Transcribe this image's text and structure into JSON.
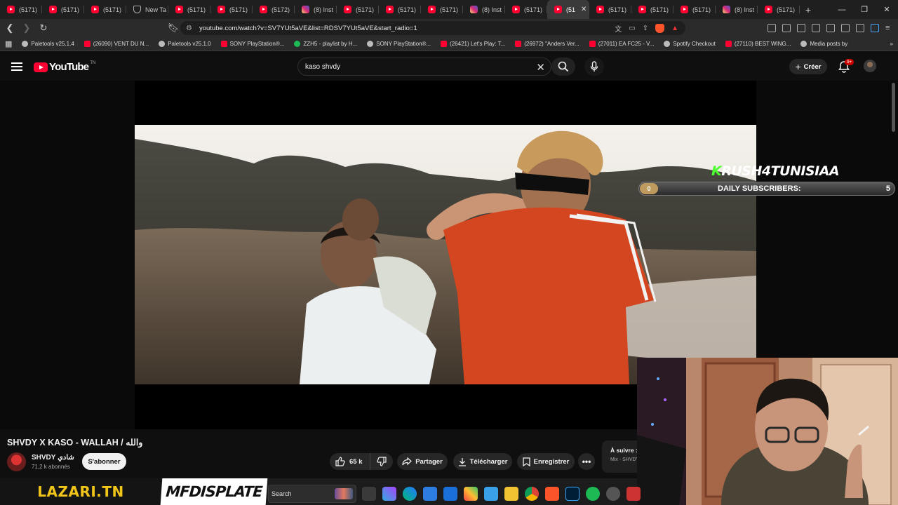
{
  "browser": {
    "tabs": [
      {
        "label": "(5171)",
        "icon": "youtube-icon"
      },
      {
        "label": "(5171)",
        "icon": "youtube-icon"
      },
      {
        "label": "(5171)",
        "icon": "youtube-icon"
      },
      {
        "label": "New Ta",
        "icon": "shield-icon"
      },
      {
        "label": "(5171)",
        "icon": "youtube-icon"
      },
      {
        "label": "(5171)",
        "icon": "youtube-icon"
      },
      {
        "label": "(5172)",
        "icon": "youtube-icon"
      },
      {
        "label": "(8) Inst",
        "icon": "instagram-icon"
      },
      {
        "label": "(5171)",
        "icon": "youtube-icon"
      },
      {
        "label": "(5171)",
        "icon": "youtube-icon"
      },
      {
        "label": "(5171)",
        "icon": "youtube-icon"
      },
      {
        "label": "(8) Inst",
        "icon": "instagram-icon"
      },
      {
        "label": "(5171)",
        "icon": "youtube-icon"
      },
      {
        "label": "(51",
        "icon": "youtube-icon",
        "active": true
      },
      {
        "label": "(5171)",
        "icon": "youtube-icon"
      },
      {
        "label": "(5171)",
        "icon": "youtube-icon"
      },
      {
        "label": "(5171)",
        "icon": "youtube-icon"
      },
      {
        "label": "(8) Inst",
        "icon": "instagram-icon"
      },
      {
        "label": "(5171)",
        "icon": "youtube-icon"
      }
    ],
    "url": "youtube.com/watch?v=SV7YUt5aVE&list=RDSV7YUt5aVE&start_radio=1",
    "bookmarks": [
      {
        "label": "Paletools v25.1.4",
        "icon": "gr"
      },
      {
        "label": "(26090) VENT DU N...",
        "icon": "yt"
      },
      {
        "label": "Paletools v25.1.0",
        "icon": "gr"
      },
      {
        "label": "SONY PlayStation®...",
        "icon": "yt"
      },
      {
        "label": "ZZH5 - playlist by H...",
        "icon": "sp"
      },
      {
        "label": "SONY PlayStation®...",
        "icon": "gr"
      },
      {
        "label": "(26421) Let's Play: T...",
        "icon": "yt"
      },
      {
        "label": "(26972) \"Anders Ver...",
        "icon": "yt"
      },
      {
        "label": "(27011) EA FC25 - V...",
        "icon": "yt"
      },
      {
        "label": "Spotify Checkout",
        "icon": "gr"
      },
      {
        "label": "(27110) BEST WING...",
        "icon": "yt"
      },
      {
        "label": "Media posts by",
        "icon": "gr"
      }
    ]
  },
  "youtube": {
    "logo_text": "YouTube",
    "country_code": "TN",
    "search_value": "kaso shvdy",
    "create_label": "Créer",
    "notifications_badge": "9+"
  },
  "overlay": {
    "channel_tag": "KRUSH4TUNISIAA",
    "daily_label": "DAILY SUBSCRIBERS:",
    "daily_start": "0",
    "daily_count": "5",
    "lazari": "LAZARI.TN",
    "mfd": "MFDISPLATE"
  },
  "video": {
    "title": "SHVDY X KASO - WALLAH / والله",
    "channel": "SHVDY شادي",
    "subscribers": "71,2 k abonnés",
    "subscribe_label": "S'abonner",
    "likes": "65 k",
    "share_label": "Partager",
    "download_label": "Télécharger",
    "save_label": "Enregistrer",
    "up_next_title": "À suivre :",
    "up_next_sub": "Mix - SHVDY"
  },
  "taskbar": {
    "search_placeholder": "Search"
  },
  "colors": {
    "accent": "#ff0033",
    "background": "#0f0f0f",
    "green_tag": "#4cff2f",
    "gold": "#f0c419"
  }
}
